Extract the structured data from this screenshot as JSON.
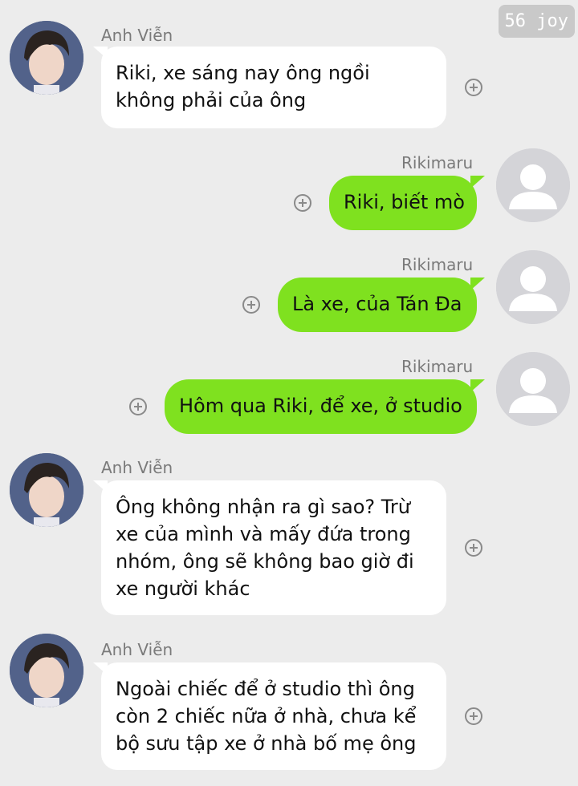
{
  "badge": "56 joy",
  "colors": {
    "incoming_bubble": "#ffffff",
    "outgoing_bubble": "#7fe11f",
    "background": "#ececec"
  },
  "messages": [
    {
      "sender": "Anh Viễn",
      "direction": "incoming",
      "lines": [
        "Riki, xe sáng nay ông ngồi",
        "không phải của ông"
      ]
    },
    {
      "sender": "Rikimaru",
      "direction": "outgoing",
      "lines": [
        "Riki, biết mò"
      ]
    },
    {
      "sender": "Rikimaru",
      "direction": "outgoing",
      "lines": [
        "Là xe, của Tán Đa"
      ]
    },
    {
      "sender": "Rikimaru",
      "direction": "outgoing",
      "lines": [
        "Hôm qua Riki, để xe, ở studio"
      ]
    },
    {
      "sender": "Anh Viễn",
      "direction": "incoming",
      "lines": [
        "Ông không nhận ra gì sao? Trừ",
        "xe của mình và mấy đứa trong",
        "nhóm, ông sẽ không bao giờ đi",
        "xe người khác"
      ]
    },
    {
      "sender": "Anh Viễn",
      "direction": "incoming",
      "lines": [
        "Ngoài chiếc để ở studio thì ông",
        "còn 2 chiếc nữa ở nhà, chưa kể",
        "bộ sưu tập xe ở nhà bố mẹ ông"
      ]
    }
  ],
  "icons": {
    "add": "plus-circle-icon",
    "avatar_default": "default-avatar-icon"
  }
}
